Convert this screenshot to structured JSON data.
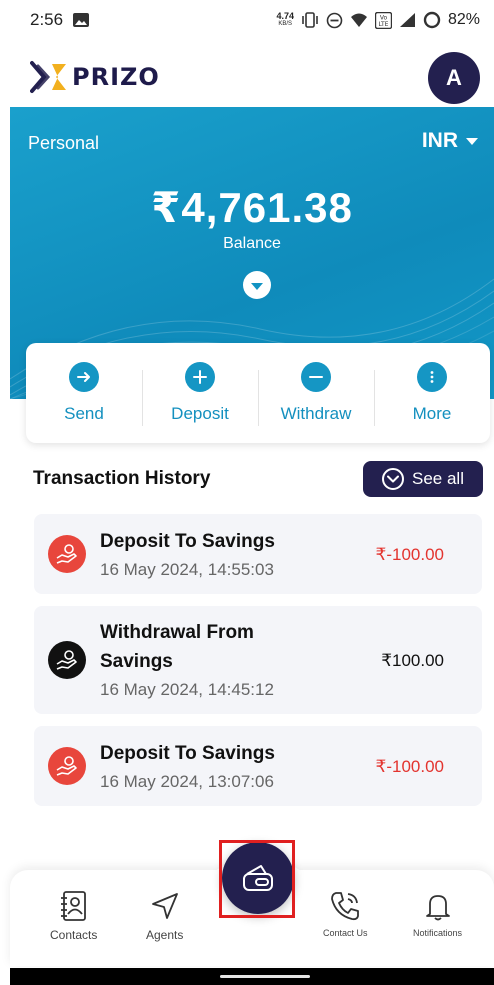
{
  "status_bar": {
    "time": "2:56",
    "net_speed_value": "4.74",
    "net_speed_unit": "KB/S",
    "battery": "82%"
  },
  "header": {
    "logo_text": "PRIZO",
    "avatar_initial": "A"
  },
  "hero": {
    "account_type": "Personal",
    "currency": "INR",
    "balance": "₹4,761.38",
    "balance_label": "Balance"
  },
  "actions": [
    {
      "label": "Send",
      "icon": "arrow-right-icon"
    },
    {
      "label": "Deposit",
      "icon": "plus-icon"
    },
    {
      "label": "Withdraw",
      "icon": "minus-icon"
    },
    {
      "label": "More",
      "icon": "more-vertical-icon"
    }
  ],
  "transactions_section": {
    "title": "Transaction History",
    "see_all_label": "See all"
  },
  "transactions": [
    {
      "title": "Deposit To Savings",
      "date": "16 May 2024, 14:55:03",
      "amount": "₹-100.00",
      "amount_color": "#e3342f",
      "icon_color": "#e8463c"
    },
    {
      "title": "Withdrawal From Savings",
      "date": "16 May 2024, 14:45:12",
      "amount": "₹100.00",
      "amount_color": "#111111",
      "icon_color": "#111111"
    },
    {
      "title": "Deposit To Savings",
      "date": "16 May 2024, 13:07:06",
      "amount": "₹-100.00",
      "amount_color": "#e3342f",
      "icon_color": "#e8463c"
    }
  ],
  "bottom_nav": {
    "items": [
      {
        "label": "Contacts",
        "icon": "contacts-book-icon"
      },
      {
        "label": "Agents",
        "icon": "send-arrow-icon"
      },
      {
        "label": "Contact Us",
        "icon": "phone-call-icon"
      },
      {
        "label": "Notifications",
        "icon": "bell-icon"
      }
    ],
    "center_icon": "wallet-icon"
  },
  "colors": {
    "brand_dark": "#23204f",
    "brand_blue": "#1596c4",
    "logo_accent": "#f2b01e",
    "negative": "#e3342f"
  }
}
